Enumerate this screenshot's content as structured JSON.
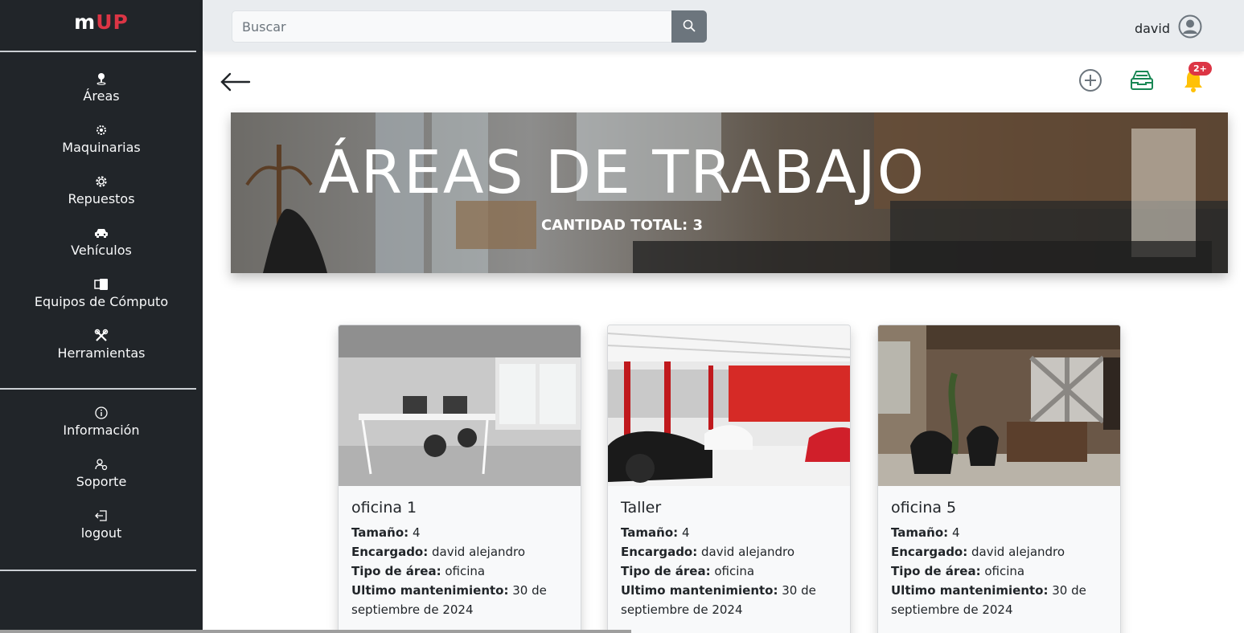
{
  "brand": {
    "m": "m",
    "up": "UP"
  },
  "sidebar": {
    "items": [
      {
        "label": "Áreas",
        "icon": "map-pin-icon"
      },
      {
        "label": "Maquinarias",
        "icon": "gear-icon"
      },
      {
        "label": "Repuestos",
        "icon": "cog-icon"
      },
      {
        "label": "Vehículos",
        "icon": "car-icon"
      },
      {
        "label": "Equipos de Cómputo",
        "icon": "devices-icon"
      },
      {
        "label": "Herramientas",
        "icon": "tools-icon"
      }
    ],
    "secondary": [
      {
        "label": "Información",
        "icon": "info-icon"
      },
      {
        "label": "Soporte",
        "icon": "user-gear-icon"
      },
      {
        "label": "logout",
        "icon": "logout-icon"
      }
    ]
  },
  "search": {
    "placeholder": "Buscar"
  },
  "user": {
    "name": "david"
  },
  "notifications": {
    "badge": "2+"
  },
  "banner": {
    "title": "ÁREAS DE TRABAJO",
    "subtitle": "CANTIDAD TOTAL: 3"
  },
  "labels": {
    "size": "Tamaño:",
    "manager": "Encargado:",
    "type": "Tipo de área:",
    "maintenance": "Ultimo mantenimiento:"
  },
  "cards": [
    {
      "title": "oficina 1",
      "size": "4",
      "manager": "david alejandro",
      "type": "oficina",
      "maintenance": "30 de septiembre de 2024"
    },
    {
      "title": "Taller",
      "size": "4",
      "manager": "david alejandro",
      "type": "oficina",
      "maintenance": "30 de septiembre de 2024"
    },
    {
      "title": "oficina 5",
      "size": "4",
      "manager": "david alejandro",
      "type": "oficina",
      "maintenance": "30 de septiembre de 2024"
    }
  ],
  "colors": {
    "sidebar": "#212529",
    "accent": "#dc3545",
    "topbar": "#e9ecef",
    "box": "#198754",
    "bell": "#ffc107"
  }
}
